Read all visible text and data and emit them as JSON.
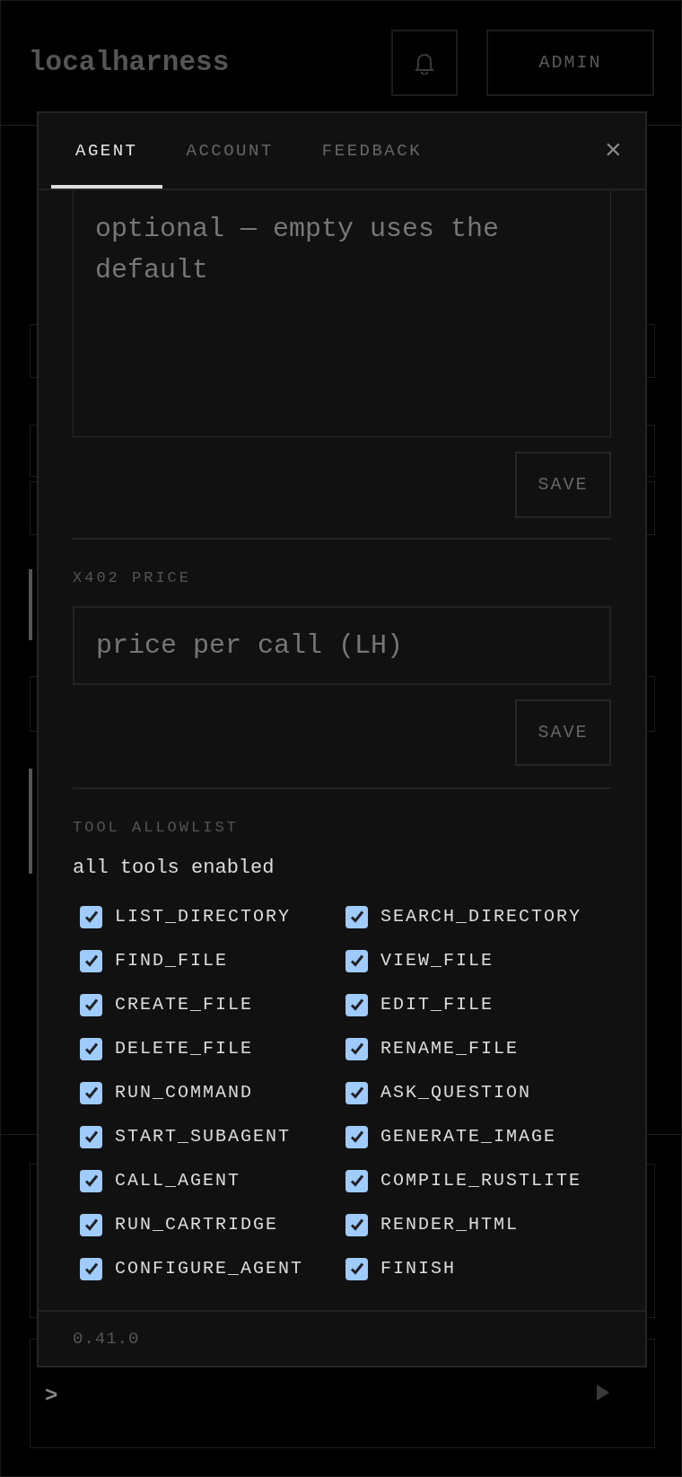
{
  "header": {
    "logo": "localharness",
    "admin_button": "ADMIN"
  },
  "dialog": {
    "tabs": [
      {
        "label": "AGENT",
        "selected": true
      },
      {
        "label": "ACCOUNT",
        "selected": false
      },
      {
        "label": "FEEDBACK",
        "selected": false
      }
    ],
    "close": "×",
    "prompt_field": {
      "placeholder": "optional — empty uses the default"
    },
    "prompt_save": "SAVE",
    "price": {
      "label": "X402 PRICE",
      "placeholder": "price per call (LH)",
      "save": "SAVE"
    },
    "tools": {
      "label": "TOOL ALLOWLIST",
      "summary": "all tools enabled",
      "items": [
        {
          "label": "LIST_DIRECTORY",
          "checked": true
        },
        {
          "label": "SEARCH_DIRECTORY",
          "checked": true
        },
        {
          "label": "FIND_FILE",
          "checked": true
        },
        {
          "label": "VIEW_FILE",
          "checked": true
        },
        {
          "label": "CREATE_FILE",
          "checked": true
        },
        {
          "label": "EDIT_FILE",
          "checked": true
        },
        {
          "label": "DELETE_FILE",
          "checked": true
        },
        {
          "label": "RENAME_FILE",
          "checked": true
        },
        {
          "label": "RUN_COMMAND",
          "checked": true
        },
        {
          "label": "ASK_QUESTION",
          "checked": true
        },
        {
          "label": "START_SUBAGENT",
          "checked": true
        },
        {
          "label": "GENERATE_IMAGE",
          "checked": true
        },
        {
          "label": "CALL_AGENT",
          "checked": true
        },
        {
          "label": "COMPILE_RUSTLITE",
          "checked": true
        },
        {
          "label": "RUN_CARTRIDGE",
          "checked": true
        },
        {
          "label": "RENDER_HTML",
          "checked": true
        },
        {
          "label": "CONFIGURE_AGENT",
          "checked": true
        },
        {
          "label": "FINISH",
          "checked": true
        }
      ]
    },
    "version": "0.41.0"
  },
  "command_bar": {
    "prompt": ">"
  }
}
